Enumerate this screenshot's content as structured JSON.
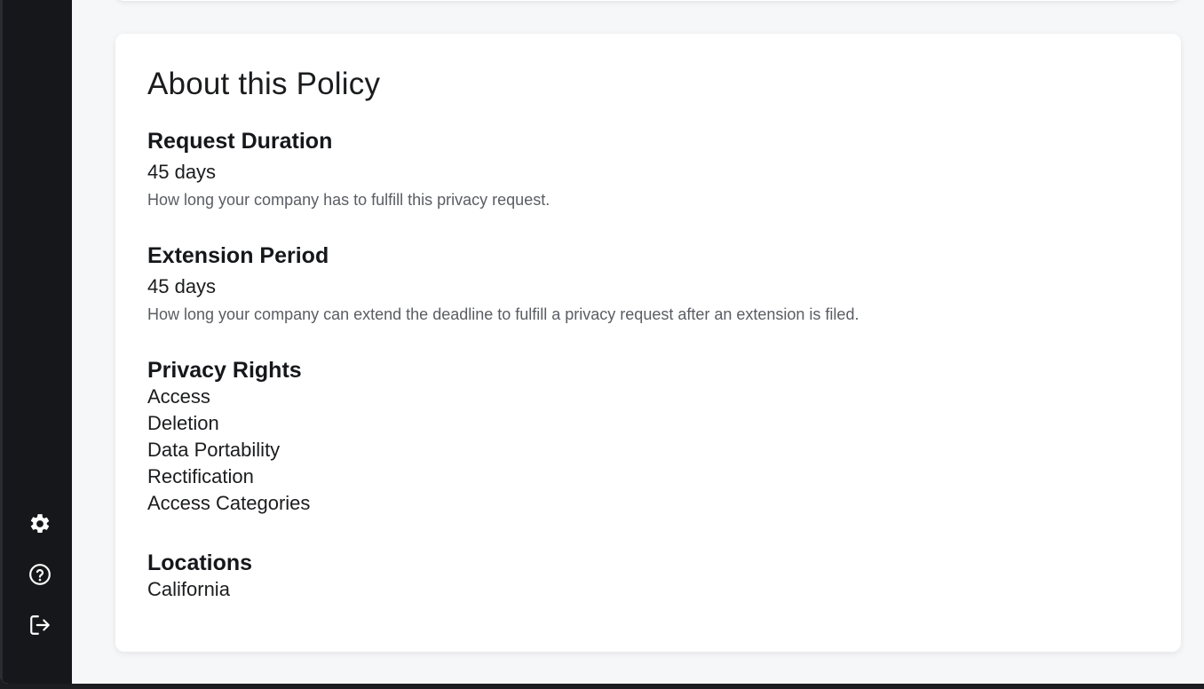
{
  "sidebar": {
    "icons": [
      {
        "name": "settings-icon"
      },
      {
        "name": "help-icon"
      },
      {
        "name": "logout-icon"
      }
    ]
  },
  "policy": {
    "title": "About this Policy",
    "request_duration": {
      "heading": "Request Duration",
      "value": "45 days",
      "help": "How long your company has to fulfill this privacy request."
    },
    "extension_period": {
      "heading": "Extension Period",
      "value": "45 days",
      "help": "How long your company can extend the deadline to fulfill a privacy request after an extension is filed."
    },
    "privacy_rights": {
      "heading": "Privacy Rights",
      "items": [
        "Access",
        "Deletion",
        "Data Portability",
        "Rectification",
        "Access Categories"
      ]
    },
    "locations": {
      "heading": "Locations",
      "items": [
        "California"
      ]
    }
  }
}
